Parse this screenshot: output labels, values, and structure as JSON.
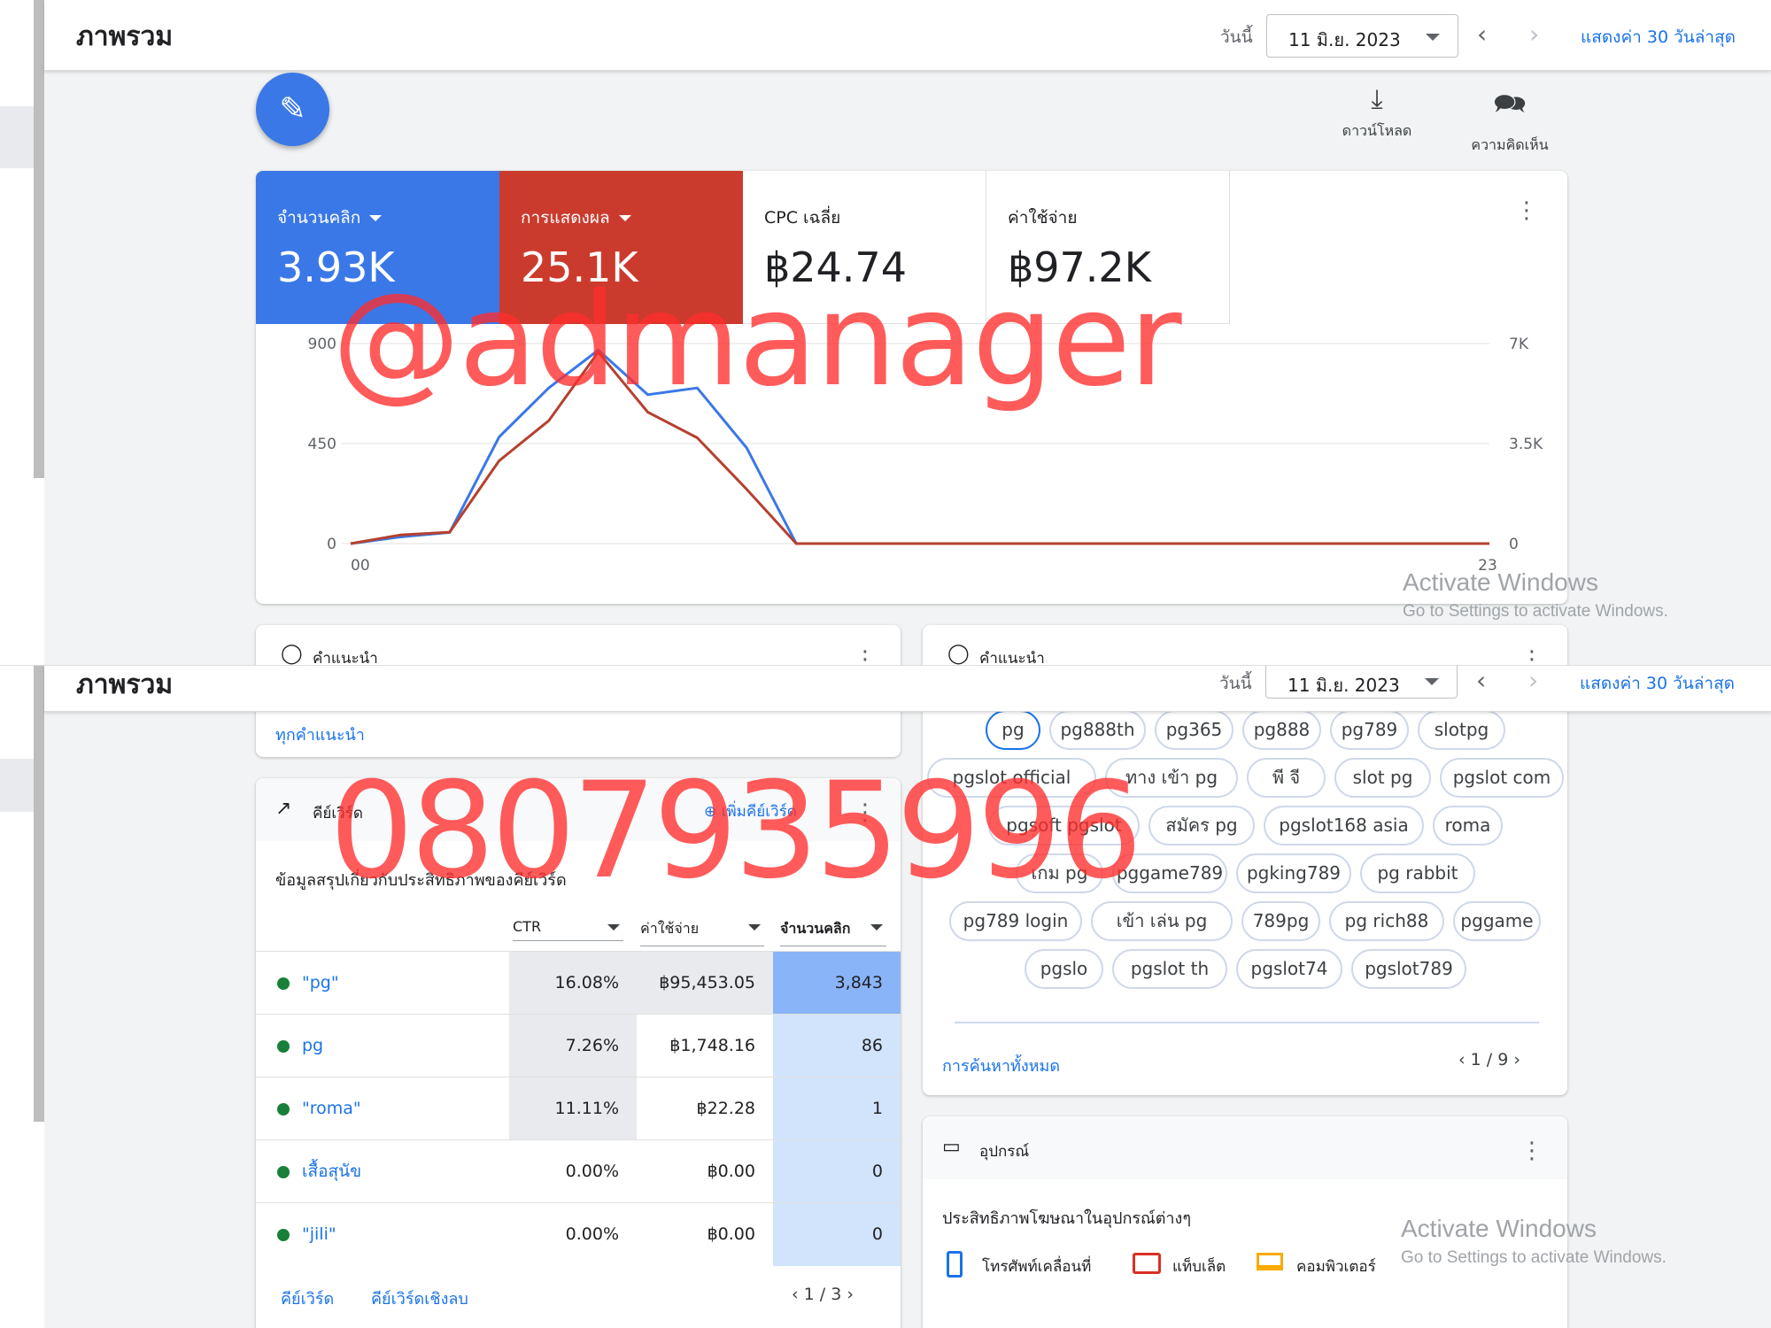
{
  "header": {
    "title": "ภาพรวม",
    "today_label": "วันนี้",
    "date": "11 มิ.ย. 2023",
    "show_last_30": "แสดงค่า 30 วันล่าสุด"
  },
  "toolbar": {
    "download_label": "ดาวน์โหลด",
    "feedback_label": "ความคิดเห็น"
  },
  "metrics": [
    {
      "label": "จำนวนคลิก",
      "value": "3.93K",
      "color": "#3b78e7"
    },
    {
      "label": "การแสดงผล",
      "value": "25.1K",
      "color": "#cb3b2d"
    },
    {
      "label": "CPC เฉลี่ย",
      "value": "฿24.74"
    },
    {
      "label": "ค่าใช้จ่าย",
      "value": "฿97.2K"
    }
  ],
  "chart_data": {
    "type": "line",
    "x_tick_labels": [
      "00",
      "23"
    ],
    "x": [
      0,
      1,
      2,
      3,
      4,
      5,
      6,
      7,
      8,
      9,
      10,
      11,
      12,
      13,
      14,
      15,
      16,
      17,
      18,
      19,
      20,
      21,
      22,
      23
    ],
    "y_left_ticks": [
      "900",
      "450",
      "0"
    ],
    "y_right_ticks": [
      "7K",
      "3.5K",
      "0"
    ],
    "ylim_left": [
      0,
      900
    ],
    "ylim_right": [
      0,
      7000
    ],
    "series": [
      {
        "axis": "left",
        "color": "#3b78e7",
        "values": [
          0,
          30,
          50,
          480,
          700,
          870,
          670,
          700,
          430,
          0,
          0,
          0,
          0,
          0,
          0,
          0,
          0,
          0,
          0,
          0,
          0,
          0,
          0,
          0
        ]
      },
      {
        "axis": "right",
        "color": "#b5412f",
        "values": [
          0,
          300,
          400,
          2900,
          4300,
          6700,
          4600,
          3700,
          1900,
          0,
          0,
          0,
          0,
          0,
          0,
          0,
          0,
          0,
          0,
          0,
          0,
          0,
          0,
          0
        ]
      }
    ],
    "grid": true
  },
  "recommendations": {
    "title": "คำแนะนำ",
    "all_link": "ทุกคำแนะนำ"
  },
  "keywords_card": {
    "title": "คีย์เวิร์ด",
    "add_label": "เพิ่มคีย์เวิร์ด",
    "subtitle": "ข้อมูลสรุปเกี่ยวกับประสิทธิภาพของคีย์เวิร์ด",
    "columns": [
      "CTR",
      "ค่าใช้จ่าย",
      "จำนวนคลิก"
    ],
    "rows": [
      {
        "keyword": "\"pg\"",
        "ctr": "16.08%",
        "cost": "฿95,453.05",
        "clicks": "3,843"
      },
      {
        "keyword": "pg",
        "ctr": "7.26%",
        "cost": "฿1,748.16",
        "clicks": "86"
      },
      {
        "keyword": "\"roma\"",
        "ctr": "11.11%",
        "cost": "฿22.28",
        "clicks": "1"
      },
      {
        "keyword": "เสื้อสุนัข",
        "ctr": "0.00%",
        "cost": "฿0.00",
        "clicks": "0"
      },
      {
        "keyword": "\"jili\"",
        "ctr": "0.00%",
        "cost": "฿0.00",
        "clicks": "0"
      }
    ],
    "footer_links": [
      "คีย์เวิร์ด",
      "คีย์เวิร์ดเชิงลบ"
    ],
    "pager": "1 / 3"
  },
  "searches_card": {
    "chips": [
      [
        "pg",
        "pg888th",
        "pg365",
        "pg888",
        "pg789",
        "slotpg"
      ],
      [
        "pgslot official",
        "ทาง เข้า pg",
        "พี จี",
        "slot pg",
        "pgslot com"
      ],
      [
        "pgsoft pgslot",
        "สมัคร pg",
        "pgslot168 asia",
        "roma"
      ],
      [
        "เกม pg",
        "pggame789",
        "pgking789",
        "pg rabbit"
      ],
      [
        "pg789 login",
        "เข้า เล่น pg",
        "789pg",
        "pg rich88",
        "pggame"
      ],
      [
        "pgslo",
        "pgslot th",
        "pgslot74",
        "pgslot789"
      ]
    ],
    "all_link": "การค้นหาทั้งหมด",
    "pager": "1 / 9"
  },
  "devices_card": {
    "title": "อุปกรณ์",
    "subtitle": "ประสิทธิภาพโฆษณาในอุปกรณ์ต่างๆ",
    "legend": [
      {
        "label": "โทรศัพท์เคลื่อนที่",
        "color": "#1a73e8"
      },
      {
        "label": "แท็บเล็ต",
        "color": "#d93025"
      },
      {
        "label": "คอมพิวเตอร์",
        "color": "#f9ab00"
      }
    ]
  },
  "overlays": {
    "watermark_top": "@admanager",
    "watermark_bottom": "0807935996",
    "activate_title": "Activate Windows",
    "activate_sub": "Go to Settings to activate Windows."
  }
}
